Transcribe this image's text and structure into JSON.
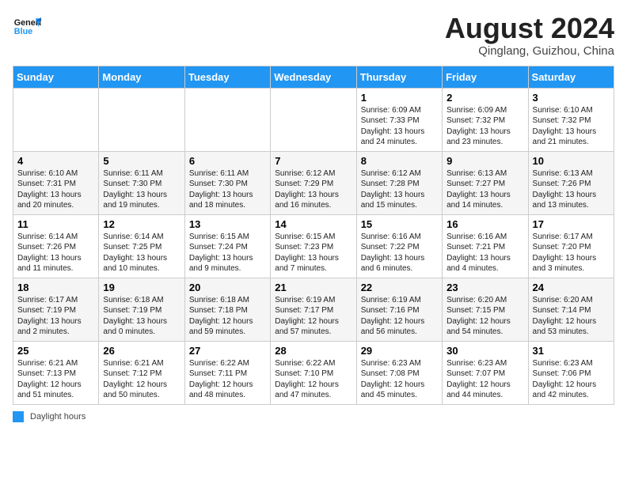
{
  "header": {
    "logo_general": "General",
    "logo_blue": "Blue",
    "month_title": "August 2024",
    "subtitle": "Qinglang, Guizhou, China"
  },
  "weekdays": [
    "Sunday",
    "Monday",
    "Tuesday",
    "Wednesday",
    "Thursday",
    "Friday",
    "Saturday"
  ],
  "legend": {
    "label": "Daylight hours"
  },
  "weeks": [
    [
      {
        "day": "",
        "info": ""
      },
      {
        "day": "",
        "info": ""
      },
      {
        "day": "",
        "info": ""
      },
      {
        "day": "",
        "info": ""
      },
      {
        "day": "1",
        "info": "Sunrise: 6:09 AM\nSunset: 7:33 PM\nDaylight: 13 hours\nand 24 minutes."
      },
      {
        "day": "2",
        "info": "Sunrise: 6:09 AM\nSunset: 7:32 PM\nDaylight: 13 hours\nand 23 minutes."
      },
      {
        "day": "3",
        "info": "Sunrise: 6:10 AM\nSunset: 7:32 PM\nDaylight: 13 hours\nand 21 minutes."
      }
    ],
    [
      {
        "day": "4",
        "info": "Sunrise: 6:10 AM\nSunset: 7:31 PM\nDaylight: 13 hours\nand 20 minutes."
      },
      {
        "day": "5",
        "info": "Sunrise: 6:11 AM\nSunset: 7:30 PM\nDaylight: 13 hours\nand 19 minutes."
      },
      {
        "day": "6",
        "info": "Sunrise: 6:11 AM\nSunset: 7:30 PM\nDaylight: 13 hours\nand 18 minutes."
      },
      {
        "day": "7",
        "info": "Sunrise: 6:12 AM\nSunset: 7:29 PM\nDaylight: 13 hours\nand 16 minutes."
      },
      {
        "day": "8",
        "info": "Sunrise: 6:12 AM\nSunset: 7:28 PM\nDaylight: 13 hours\nand 15 minutes."
      },
      {
        "day": "9",
        "info": "Sunrise: 6:13 AM\nSunset: 7:27 PM\nDaylight: 13 hours\nand 14 minutes."
      },
      {
        "day": "10",
        "info": "Sunrise: 6:13 AM\nSunset: 7:26 PM\nDaylight: 13 hours\nand 13 minutes."
      }
    ],
    [
      {
        "day": "11",
        "info": "Sunrise: 6:14 AM\nSunset: 7:26 PM\nDaylight: 13 hours\nand 11 minutes."
      },
      {
        "day": "12",
        "info": "Sunrise: 6:14 AM\nSunset: 7:25 PM\nDaylight: 13 hours\nand 10 minutes."
      },
      {
        "day": "13",
        "info": "Sunrise: 6:15 AM\nSunset: 7:24 PM\nDaylight: 13 hours\nand 9 minutes."
      },
      {
        "day": "14",
        "info": "Sunrise: 6:15 AM\nSunset: 7:23 PM\nDaylight: 13 hours\nand 7 minutes."
      },
      {
        "day": "15",
        "info": "Sunrise: 6:16 AM\nSunset: 7:22 PM\nDaylight: 13 hours\nand 6 minutes."
      },
      {
        "day": "16",
        "info": "Sunrise: 6:16 AM\nSunset: 7:21 PM\nDaylight: 13 hours\nand 4 minutes."
      },
      {
        "day": "17",
        "info": "Sunrise: 6:17 AM\nSunset: 7:20 PM\nDaylight: 13 hours\nand 3 minutes."
      }
    ],
    [
      {
        "day": "18",
        "info": "Sunrise: 6:17 AM\nSunset: 7:19 PM\nDaylight: 13 hours\nand 2 minutes."
      },
      {
        "day": "19",
        "info": "Sunrise: 6:18 AM\nSunset: 7:19 PM\nDaylight: 13 hours\nand 0 minutes."
      },
      {
        "day": "20",
        "info": "Sunrise: 6:18 AM\nSunset: 7:18 PM\nDaylight: 12 hours\nand 59 minutes."
      },
      {
        "day": "21",
        "info": "Sunrise: 6:19 AM\nSunset: 7:17 PM\nDaylight: 12 hours\nand 57 minutes."
      },
      {
        "day": "22",
        "info": "Sunrise: 6:19 AM\nSunset: 7:16 PM\nDaylight: 12 hours\nand 56 minutes."
      },
      {
        "day": "23",
        "info": "Sunrise: 6:20 AM\nSunset: 7:15 PM\nDaylight: 12 hours\nand 54 minutes."
      },
      {
        "day": "24",
        "info": "Sunrise: 6:20 AM\nSunset: 7:14 PM\nDaylight: 12 hours\nand 53 minutes."
      }
    ],
    [
      {
        "day": "25",
        "info": "Sunrise: 6:21 AM\nSunset: 7:13 PM\nDaylight: 12 hours\nand 51 minutes."
      },
      {
        "day": "26",
        "info": "Sunrise: 6:21 AM\nSunset: 7:12 PM\nDaylight: 12 hours\nand 50 minutes."
      },
      {
        "day": "27",
        "info": "Sunrise: 6:22 AM\nSunset: 7:11 PM\nDaylight: 12 hours\nand 48 minutes."
      },
      {
        "day": "28",
        "info": "Sunrise: 6:22 AM\nSunset: 7:10 PM\nDaylight: 12 hours\nand 47 minutes."
      },
      {
        "day": "29",
        "info": "Sunrise: 6:23 AM\nSunset: 7:08 PM\nDaylight: 12 hours\nand 45 minutes."
      },
      {
        "day": "30",
        "info": "Sunrise: 6:23 AM\nSunset: 7:07 PM\nDaylight: 12 hours\nand 44 minutes."
      },
      {
        "day": "31",
        "info": "Sunrise: 6:23 AM\nSunset: 7:06 PM\nDaylight: 12 hours\nand 42 minutes."
      }
    ]
  ]
}
